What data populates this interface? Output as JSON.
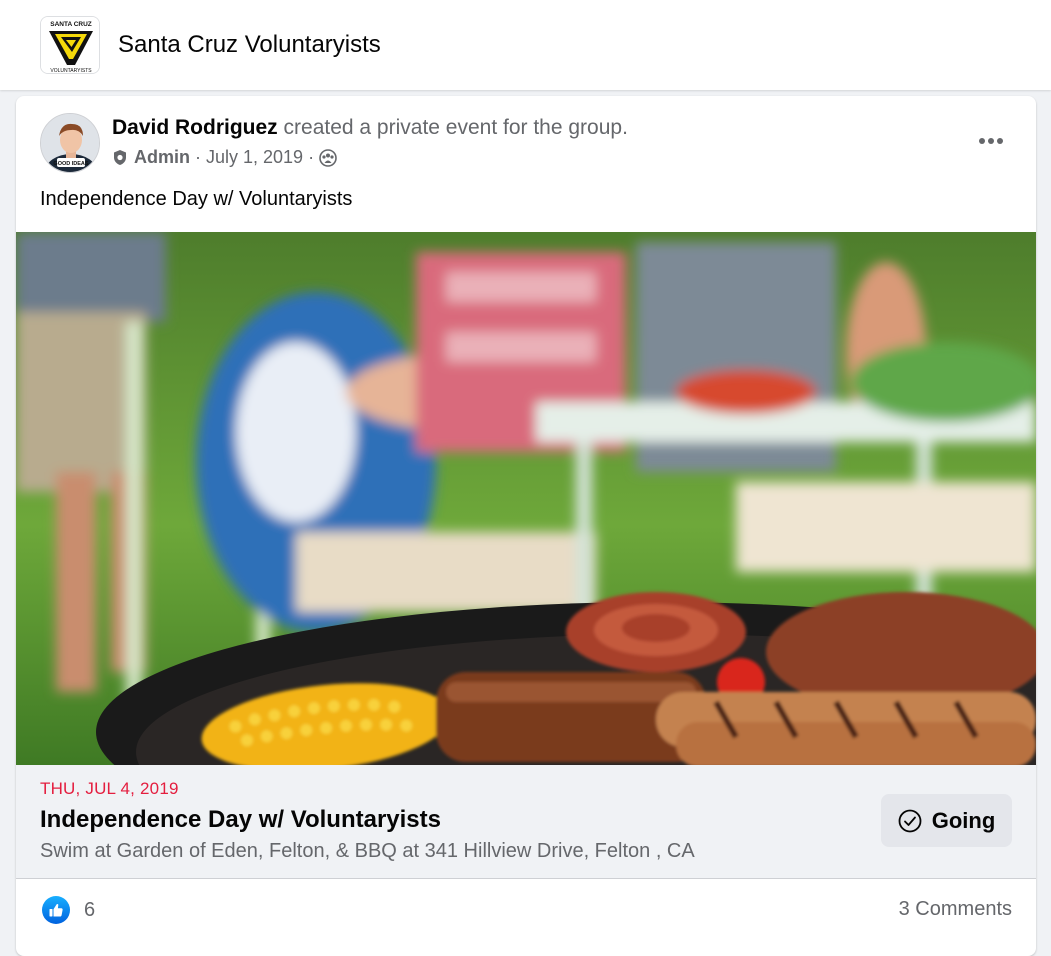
{
  "group": {
    "name": "Santa Cruz Voluntaryists",
    "logo_top_text": "SANTA CRUZ",
    "logo_bottom_text": "VOLUNTARYISTS"
  },
  "post": {
    "author": "David Rodriguez",
    "action": "created a private event for the group.",
    "role": "Admin",
    "date": "July 1, 2019",
    "sep1": "·",
    "sep2": "·",
    "text": "Independence Day w/ Voluntaryists",
    "avatar_caption": "GOOD IDEAS"
  },
  "event": {
    "date": "THU, JUL 4, 2019",
    "title": "Independence Day w/ Voluntaryists",
    "location": "Swim at Garden of Eden, Felton, & BBQ at 341 Hillview Drive, Felton , CA",
    "rsvp_label": "Going"
  },
  "footer": {
    "like_count": "6",
    "comments": "3 Comments"
  },
  "colors": {
    "date_red": "#e41e3f",
    "like_blue": "#0866ff",
    "muted_text": "#65676b"
  }
}
